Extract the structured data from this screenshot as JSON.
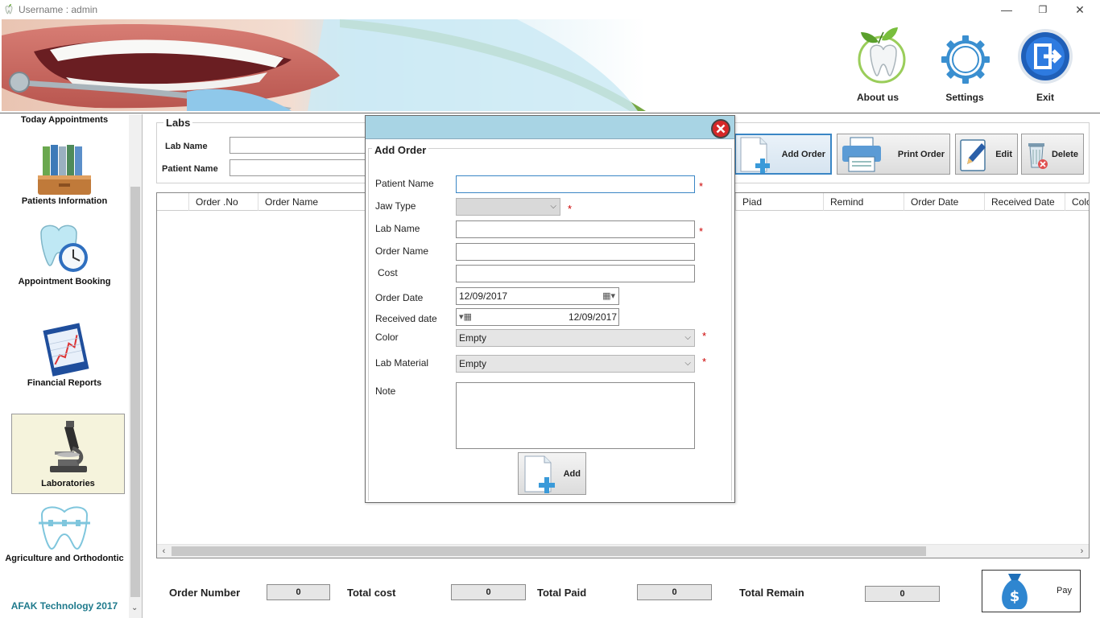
{
  "window": {
    "title": "Username : admin",
    "minimize": "—",
    "restore": "❐",
    "close": "✕"
  },
  "header": {
    "about": "About us",
    "settings": "Settings",
    "exit": "Exit"
  },
  "sidebar": {
    "items": [
      {
        "label": "Today Appointments"
      },
      {
        "label": "Patients Information"
      },
      {
        "label": "Appointment Booking"
      },
      {
        "label": "Financial Reports"
      },
      {
        "label": "Laboratories"
      },
      {
        "label": "Agriculture and Orthodontic"
      }
    ],
    "footer": "AFAK Technology 2017"
  },
  "labs": {
    "legend": "Labs",
    "lab_name_label": "Lab Name",
    "patient_name_label": "Patient Name"
  },
  "toolbar": {
    "add_order": "Add Order",
    "print_order": "Print Order",
    "edit": "Edit",
    "delete": "Delete"
  },
  "grid": {
    "columns": [
      "",
      "Order .No",
      "Order Name",
      "Piad",
      "Remind",
      "Order Date",
      "Received Date",
      "Colo"
    ]
  },
  "totals": {
    "order_number_label": "Order Number",
    "order_number": "0",
    "total_cost_label": "Total cost",
    "total_cost": "0",
    "total_paid_label": "Total Paid",
    "total_paid": "0",
    "total_remain_label": "Total Remain",
    "total_remain": "0",
    "pay_label": "Pay"
  },
  "dialog": {
    "legend": "Add Order",
    "patient_name_label": "Patient Name",
    "jaw_type_label": "Jaw Type",
    "lab_name_label": "Lab Name",
    "order_name_label": "Order Name",
    "cost_label": "Cost",
    "order_date_label": "Order Date",
    "order_date": "12/09/2017",
    "received_date_label": "Received date",
    "received_date": "12/09/2017",
    "color_label": "Color",
    "color_value": "Empty",
    "lab_material_label": "Lab Material",
    "lab_material_value": "Empty",
    "note_label": "Note",
    "add_button": "Add",
    "required_mark": "*"
  },
  "colors": {
    "dialog_title": "#a8d4e4",
    "accent": "#3a86c5",
    "footer_text": "#1f7a8c",
    "required": "#cc0000"
  }
}
